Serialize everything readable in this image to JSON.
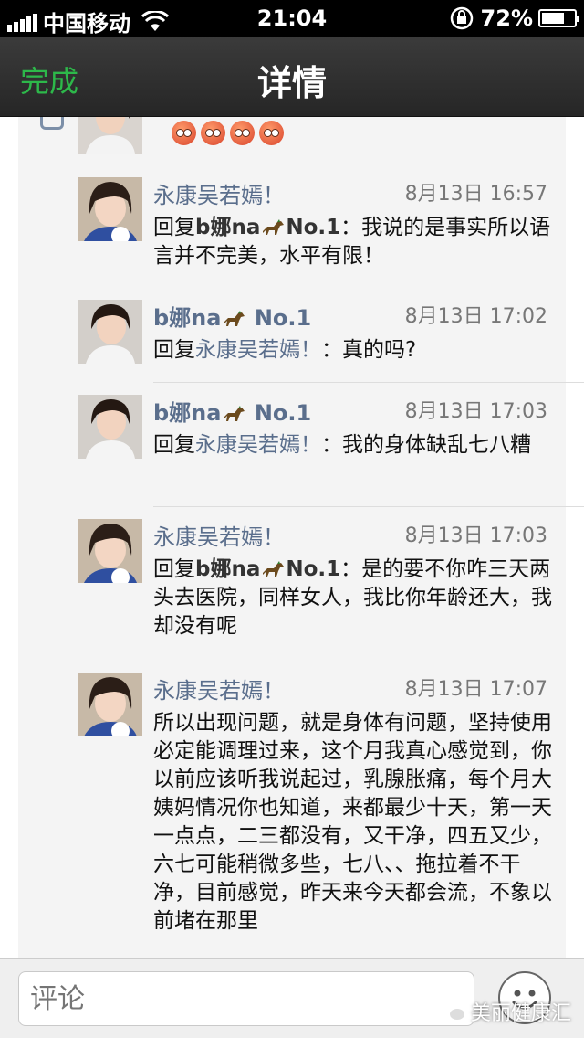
{
  "status_bar": {
    "carrier": "中国移动",
    "time": "21:04",
    "battery": "72%"
  },
  "nav": {
    "done_label": "完成",
    "title": "详情"
  },
  "comments": [
    {
      "name": "永康吴若嫣！",
      "time": "8月13日 16:57",
      "reply_prefix": "回复",
      "reply_to": "b娜na",
      "reply_to_suffix": "No.1",
      "text": "：我说的是事实所以语言并不完美，水平有限！"
    },
    {
      "name": "b娜na",
      "name_suffix": "No.1",
      "time": "8月13日 17:02",
      "reply_prefix": "回复",
      "reply_to": "永康吴若嫣！",
      "text": "：真的吗?"
    },
    {
      "name": "b娜na",
      "name_suffix": "No.1",
      "time": "8月13日 17:03",
      "reply_prefix": "回复",
      "reply_to": "永康吴若嫣！",
      "text": "：我的身体缺乱七八糟"
    },
    {
      "name": "永康吴若嫣！",
      "time": "8月13日 17:03",
      "reply_prefix": "回复",
      "reply_to": "b娜na",
      "reply_to_suffix": "No.1",
      "text": "：是的要不你咋三天两头去医院，同样女人，我比你年龄还大，我却没有呢"
    },
    {
      "name": "永康吴若嫣！",
      "time": "8月13日 17:07",
      "text": "所以出现问题，就是身体有问题，坚持使用必定能调理过来，这个月我真心感觉到，你以前应该听我说起过，乳腺胀痛，每个月大姨妈情况你也知道，来都最少十天，第一天一点点，二三都没有，又干净，四五又少，六七可能稍微多些，七八、、拖拉着不干净，目前感觉，昨天来今天都会流，不象以前堵在那里"
    }
  ],
  "bottom": {
    "comment_placeholder": "评论",
    "watermark": "美丽健康汇"
  }
}
